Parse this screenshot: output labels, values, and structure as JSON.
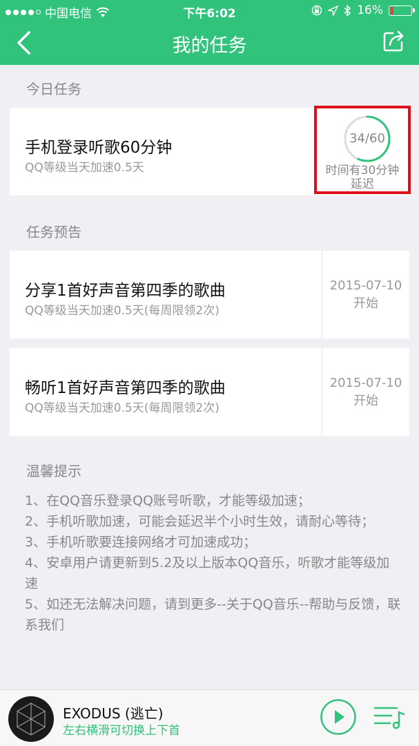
{
  "status_bar": {
    "carrier": "中国电信",
    "time": "下午6:02",
    "battery": "16%",
    "battery_level": 0.16
  },
  "nav": {
    "title": "我的任务",
    "back_icon": "chevron-left-icon",
    "share_icon": "share-icon"
  },
  "today": {
    "section_label": "今日任务",
    "task": {
      "title": "手机登录听歌60分钟",
      "subtitle": "QQ等级当天加速0.5天",
      "progress_text": "34/60",
      "progress_value": 34,
      "progress_max": 60,
      "note_line1": "时间有30分钟",
      "note_line2": "延迟"
    }
  },
  "preview": {
    "section_label": "任务预告",
    "tasks": [
      {
        "title": "分享1首好声音第四季的歌曲",
        "subtitle": "QQ等级当天加速0.5天(每周限领2次)",
        "date": "2015-07-10",
        "start": "开始"
      },
      {
        "title": "畅听1首好声音第四季的歌曲",
        "subtitle": "QQ等级当天加速0.5天(每周限领2次)",
        "date": "2015-07-10",
        "start": "开始"
      }
    ]
  },
  "tips": {
    "title": "温馨提示",
    "items": [
      "1、在QQ音乐登录QQ账号听歌，才能等级加速；",
      "2、手机听歌加速，可能会延迟半个小时生效，请耐心等待；",
      "3、手机听歌要连接网络才可加速成功；",
      "4、安卓用户请更新到5.2及以上版本QQ音乐，听歌才能等级加速",
      "5、如还无法解决问题，请到更多--关于QQ音乐--帮助与反馈，联系我们"
    ]
  },
  "player": {
    "song_title": "EXODUS (逃亡)",
    "hint": "左右横滑可切换上下首"
  },
  "colors": {
    "brand_green": "#31c27c",
    "highlight_red": "#e0101b"
  }
}
